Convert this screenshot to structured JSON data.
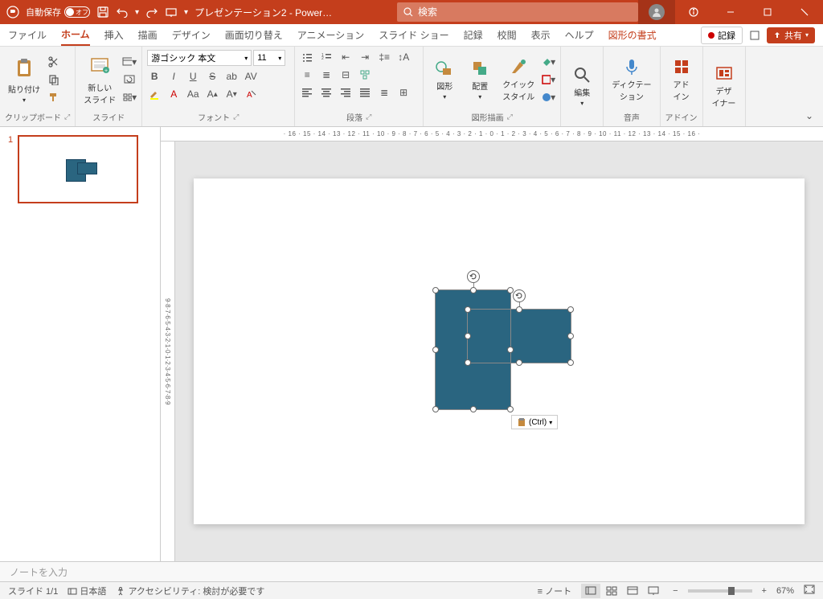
{
  "titlebar": {
    "autosave_label": "自動保存",
    "autosave_state": "オフ",
    "title": "プレゼンテーション2 - Power…",
    "search_placeholder": "検索"
  },
  "tabs": {
    "file": "ファイル",
    "home": "ホーム",
    "insert": "挿入",
    "draw": "描画",
    "design": "デザイン",
    "transitions": "画面切り替え",
    "animations": "アニメーション",
    "slideshow": "スライド ショー",
    "record": "記録",
    "review": "校閲",
    "view": "表示",
    "help": "ヘルプ",
    "shape_format": "図形の書式",
    "rec_btn": "記録",
    "share": "共有"
  },
  "ribbon": {
    "clipboard": {
      "paste": "貼り付け",
      "label": "クリップボード"
    },
    "slides": {
      "new_slide": "新しい\nスライド",
      "label": "スライド"
    },
    "font": {
      "name": "游ゴシック 本文",
      "size": "11",
      "label": "フォント"
    },
    "paragraph": {
      "label": "段落"
    },
    "drawing": {
      "shapes": "図形",
      "arrange": "配置",
      "quick_styles": "クイック\nスタイル",
      "label": "図形描画"
    },
    "editing": {
      "label": "編集"
    },
    "voice": {
      "dictate": "ディクテー\nション",
      "label": "音声"
    },
    "addins": {
      "addin": "アド\nイン",
      "label": "アドイン"
    },
    "designer": {
      "designer": "デザ\nイナー"
    }
  },
  "slide": {
    "ctrl_tag": "(Ctrl)",
    "thumb_number": "1"
  },
  "notes": {
    "placeholder": "ノートを入力"
  },
  "status": {
    "slide": "スライド 1/1",
    "lang": "日本語",
    "accessibility": "アクセシビリティ: 検討が必要です",
    "notes_btn": "ノート",
    "zoom": "67%"
  }
}
